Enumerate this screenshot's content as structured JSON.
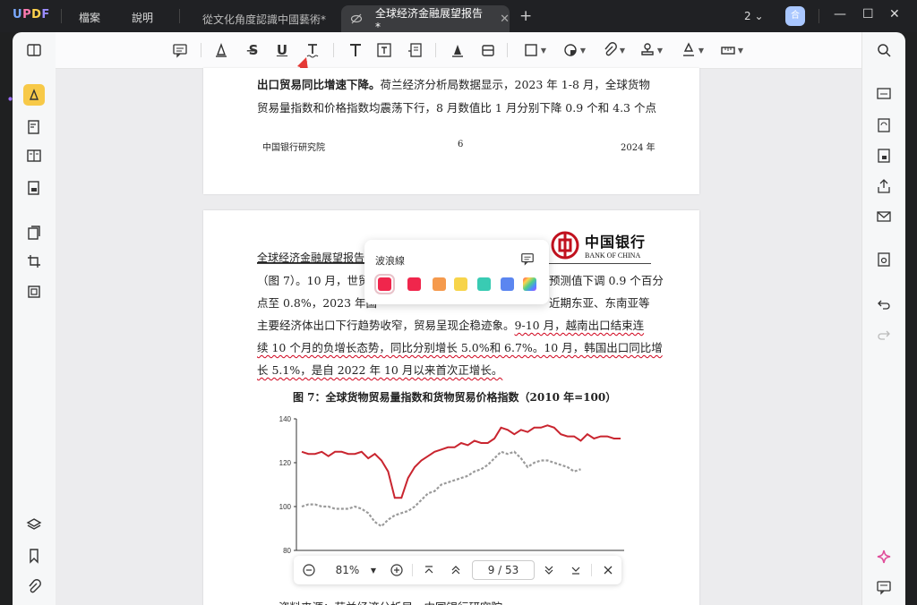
{
  "app": {
    "logo": "UPDF",
    "menus": [
      "檔案",
      "說明"
    ],
    "tabs": [
      {
        "title": "從文化角度認識中國藝術*",
        "active": false
      },
      {
        "title": "全球经济金融展望报告*",
        "active": true
      }
    ],
    "page_count_label": "2",
    "avatar_initial": "合"
  },
  "document": {
    "page1": {
      "line1_bold": "出口贸易同比增速下降。",
      "line1_rest": "荷兰经济分析局数据显示，2023 年 1-8 月，全球货物",
      "line2": "贸易量指数和价格指数均震荡下行，8 月数值比 1 月分别下降 0.9 个和 4.3 个点",
      "footer_left": "中国银行研究院",
      "footer_center": "6",
      "footer_right": "2024 年"
    },
    "page2": {
      "header_title": "全球经济金融展望报告",
      "logo_cn": "中国银行",
      "logo_en": "BANK OF CHINA",
      "para": [
        "（图 7）。10 月，世贸",
        "预测值下调 0.9 个百分",
        "点至 0.8%，2023 年国",
        "近期东亚、东南亚等",
        "主要经济体出口下行趋势收窄，贸易呈现企稳迹象。",
        "9-10 月，越南出口结束连",
        "续 10 个月的负增长态势，同比分别增长 5.0%和 6.7%。10 月，韩国出口同比增",
        "长 5.1%，是自 2022 年 10 月以来首次正增长。"
      ],
      "figure_caption": "图 7：全球货物贸易量指数和货物贸易价格指数（2010 年=100）",
      "source_note": "资料来源：荷兰经济分析局，中国银行研究院"
    }
  },
  "popup": {
    "title": "波浪線",
    "colors": [
      "#f0264c",
      "#f0264c",
      "#f59a4d",
      "#f7d44a",
      "#39cbb3",
      "#5b86f0",
      "rainbow"
    ]
  },
  "bottom": {
    "zoom": "81%",
    "page_current": "9",
    "page_total": "/ 53"
  },
  "colors": {
    "accent_red": "#d0021b",
    "chart_red": "#c9252f",
    "chart_gray": "#9a9a9a"
  },
  "chart_data": {
    "type": "line",
    "title": "图 7：全球货物贸易量指数和货物贸易价格指数（2010 年=100）",
    "ylim": [
      80,
      140
    ],
    "yticks": [
      80,
      100,
      120,
      140
    ],
    "series": [
      {
        "values": [
          125,
          124,
          124,
          125,
          123,
          125,
          125,
          124,
          124,
          125,
          122,
          124,
          121,
          116,
          104,
          104,
          113,
          118,
          121,
          123,
          125,
          126,
          127,
          127,
          129,
          128,
          130,
          129,
          129,
          131,
          136,
          135,
          133,
          135,
          134,
          136,
          136,
          137,
          136,
          133,
          132,
          132,
          130,
          133,
          131,
          132,
          132,
          131,
          131
        ]
      },
      {
        "values": [
          100,
          101,
          101,
          100,
          100,
          99,
          99,
          99,
          100,
          99,
          97,
          93,
          91,
          94,
          96,
          97,
          98,
          100,
          103,
          106,
          107,
          110,
          111,
          112,
          113,
          114,
          116,
          117,
          119,
          122,
          125,
          124,
          125,
          122,
          118,
          120,
          121,
          121,
          120,
          119,
          118,
          116,
          117
        ]
      }
    ]
  }
}
